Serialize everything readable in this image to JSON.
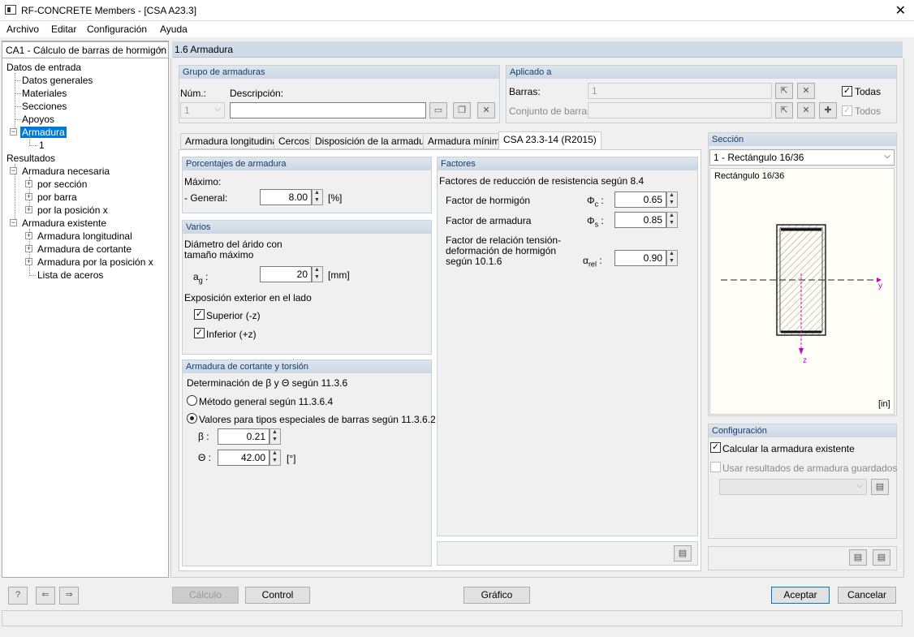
{
  "window": {
    "title": "RF-CONCRETE Members - [CSA A23.3]"
  },
  "menu": {
    "items": [
      "Archivo",
      "Editar",
      "Configuración",
      "Ayuda"
    ]
  },
  "case_select": {
    "value": "CA1 - Cálculo de barras de hormigón"
  },
  "tree": {
    "input": "Datos de entrada",
    "general": "Datos generales",
    "materials": "Materiales",
    "sections": "Secciones",
    "supports": "Apoyos",
    "reinforcement": "Armadura",
    "reinf_child": "1",
    "results": "Resultados",
    "required": "Armadura necesaria",
    "by_section": "por sección",
    "by_member": "por barra",
    "by_x": "por la posición x",
    "existing": "Armadura existente",
    "longitudinal": "Armadura longitudinal",
    "shear": "Armadura de cortante",
    "by_x2": "Armadura por la posición x",
    "steel_list": "Lista de aceros"
  },
  "header": {
    "title": "1.6 Armadura"
  },
  "group": {
    "title": "Grupo de armaduras",
    "num_label": "Núm.:",
    "num_value": "1",
    "desc_label": "Descripción:",
    "desc_value": ""
  },
  "applied": {
    "title": "Aplicado a",
    "members_label": "Barras:",
    "members_value": "1",
    "all_label": "Todas",
    "sets_label": "Conjunto de barras:",
    "sets_value": "",
    "all2_label": "Todos"
  },
  "tabs": [
    "Armadura longitudinal",
    "Cercos",
    "Disposición de la armadura",
    "Armadura mínima",
    "CSA 23.3-14 (R2015)"
  ],
  "percent": {
    "title": "Porcentajes de armadura",
    "max_label": "Máximo:",
    "general_label": "- General:",
    "general_value": "8.00",
    "unit": "[%]"
  },
  "various": {
    "title": "Varios",
    "agg_label": "Diámetro del árido con tamaño máximo",
    "ag_label": "a",
    "ag_sub": "g",
    "ag_colon": ":",
    "ag_value": "20",
    "ag_unit": "[mm]",
    "exp_label": "Exposición exterior en el lado",
    "top_label": "Superior (-z)",
    "bottom_label": "Inferior (+z)"
  },
  "shear": {
    "title": "Armadura de cortante y torsión",
    "det_label": "Determinación de β y Θ según 11.3.6",
    "opt1": "Método general según 11.3.6.4",
    "opt2": "Valores para tipos especiales de barras según 11.3.6.2",
    "beta_label": "β :",
    "beta_value": "0.21",
    "theta_label": "Θ :",
    "theta_value": "42.00",
    "theta_unit": "[°]"
  },
  "factors": {
    "title": "Factores",
    "subtitle": "Factores de reducción de resistencia según 8.4",
    "concrete_label": "Factor de hormigón",
    "concrete_sym": "Φ",
    "concrete_sub": "c",
    "concrete_value": "0.65",
    "steel_label": "Factor de armadura",
    "steel_sym": "Φ",
    "steel_sub": "s",
    "steel_value": "0.85",
    "rel_label": "Factor de relación tensión-deformación de hormigón según 10.1.6",
    "rel_sym": "α",
    "rel_sub": "rel",
    "rel_value": "0.90"
  },
  "section": {
    "title": "Sección",
    "select": "1 - Rectángulo 16/36",
    "name": "Rectángulo 16/36",
    "y_axis": "y",
    "z_axis": "z",
    "unit": "[in]"
  },
  "config": {
    "title": "Configuración",
    "calc_existing": "Calcular la armadura existente",
    "use_saved": "Usar resultados de armadura guardados"
  },
  "buttons": {
    "calc": "Cálculo",
    "control": "Control",
    "graphic": "Gráfico",
    "accept": "Aceptar",
    "cancel": "Cancelar"
  }
}
